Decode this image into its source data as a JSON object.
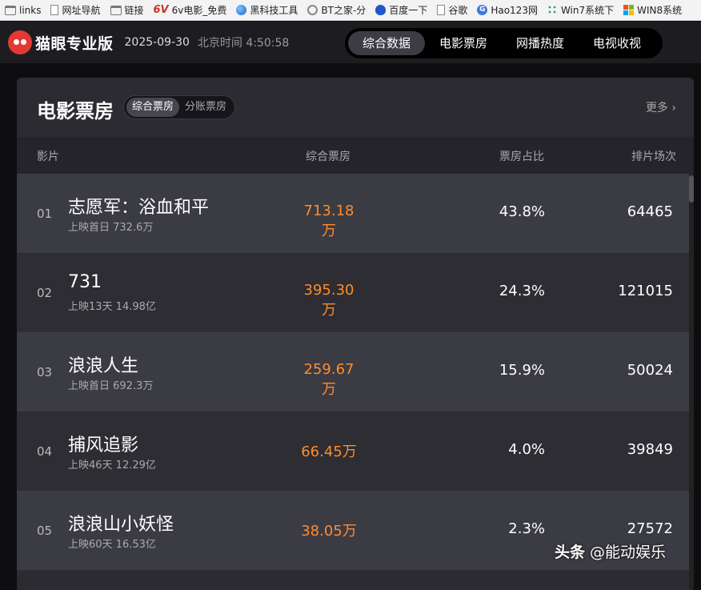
{
  "bookmarks": [
    {
      "label": "links",
      "icon": "folder-icon"
    },
    {
      "label": "网址导航",
      "icon": "page-icon"
    },
    {
      "label": "链接",
      "icon": "folder-icon"
    },
    {
      "label": "6v电影_免费",
      "icon": "6v-icon"
    },
    {
      "label": "黑科技工具",
      "icon": "globe-icon"
    },
    {
      "label": "BT之家-分",
      "icon": "bt-icon"
    },
    {
      "label": "百度一下",
      "icon": "paw-icon"
    },
    {
      "label": "谷歌",
      "icon": "page-icon"
    },
    {
      "label": "Hao123网",
      "icon": "g-icon"
    },
    {
      "label": "Win7系统下",
      "icon": "dots-icon"
    },
    {
      "label": "WIN8系统",
      "icon": "win-icon"
    }
  ],
  "header": {
    "logo_text": "猫眼专业版",
    "date": "2025-09-30",
    "clock": "北京时间 4:50:58",
    "tabs": [
      "综合数据",
      "电影票房",
      "网播热度",
      "电视收视"
    ],
    "active_tab": 0
  },
  "card": {
    "title": "电影票房",
    "toggle": [
      "综合票房",
      "分账票房"
    ],
    "more": "更多",
    "columns": {
      "film": "影片",
      "box": "综合票房",
      "ratio": "票房占比",
      "shows": "排片场次"
    }
  },
  "movies": [
    {
      "rank": "01",
      "name": "志愿军：浴血和平",
      "sub": "上映首日  732.6万",
      "box": "713.18万",
      "ratio": "43.8%",
      "shows": "64465"
    },
    {
      "rank": "02",
      "name": "731",
      "sub": "上映13天  14.98亿",
      "box": "395.30万",
      "ratio": "24.3%",
      "shows": "121015"
    },
    {
      "rank": "03",
      "name": "浪浪人生",
      "sub": "上映首日  692.3万",
      "box": "259.67万",
      "ratio": "15.9%",
      "shows": "50024"
    },
    {
      "rank": "04",
      "name": "捕风追影",
      "sub": "上映46天  12.29亿",
      "box": "66.45万",
      "ratio": "4.0%",
      "shows": "39849"
    },
    {
      "rank": "05",
      "name": "浪浪山小妖怪",
      "sub": "上映60天  16.53亿",
      "box": "38.05万",
      "ratio": "2.3%",
      "shows": "27572"
    }
  ],
  "watermark": {
    "brand": "头条",
    "handle": "@能动娱乐"
  },
  "colors": {
    "accent_box": "#ff8c2b",
    "logo_red": "#e23a33"
  }
}
